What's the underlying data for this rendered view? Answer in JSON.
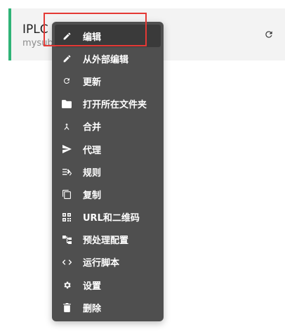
{
  "card": {
    "title": "IPLC V",
    "subtitle": "mysub"
  },
  "menu": {
    "items": [
      {
        "label": "编辑",
        "icon": "pencil-icon",
        "active": true
      },
      {
        "label": "从外部编辑",
        "icon": "pencil-icon"
      },
      {
        "label": "更新",
        "icon": "refresh-icon"
      },
      {
        "label": "打开所在文件夹",
        "icon": "folder-icon"
      },
      {
        "label": "合并",
        "icon": "merge-icon"
      },
      {
        "label": "代理",
        "icon": "send-icon"
      },
      {
        "label": "规则",
        "icon": "rules-icon"
      },
      {
        "label": "复制",
        "icon": "copy-icon"
      },
      {
        "label": "URL和二维码",
        "icon": "qrcode-icon"
      },
      {
        "label": "预处理配置",
        "icon": "tree-icon"
      },
      {
        "label": "运行脚本",
        "icon": "code-icon"
      },
      {
        "label": "设置",
        "icon": "gear-icon"
      },
      {
        "label": "删除",
        "icon": "trash-icon"
      }
    ]
  },
  "colors": {
    "accent": "#2fb377",
    "menu_bg": "#4f4f4f",
    "highlight_border": "#e53935"
  }
}
